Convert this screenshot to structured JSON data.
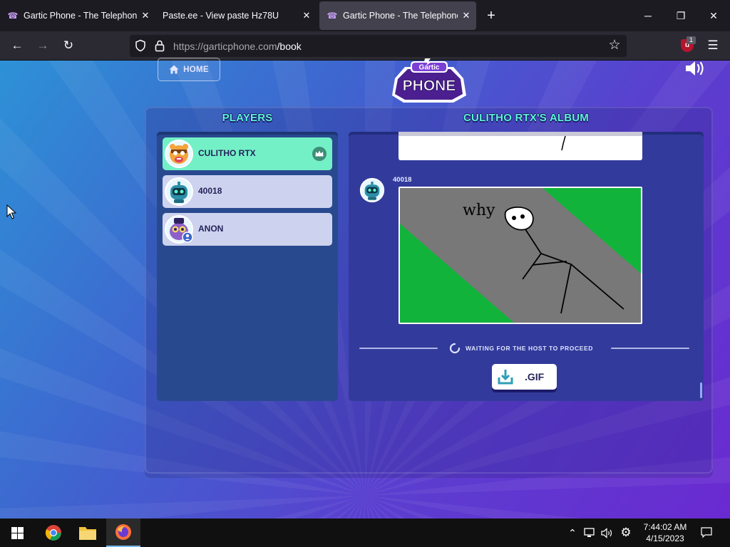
{
  "browser": {
    "tabs": [
      {
        "title": "Gartic Phone - The Telephone G",
        "active": false
      },
      {
        "title": "Paste.ee - View paste Hz78U",
        "active": false
      },
      {
        "title": "Gartic Phone - The Telephone G",
        "active": true
      }
    ],
    "url_host": "https://garticphone.com",
    "url_path": "/book",
    "extension_badge": "1",
    "colors": {
      "chrome_bg": "#1c1b22",
      "toolbar_bg": "#2b2a33",
      "active_tab": "#42414d"
    }
  },
  "game": {
    "home_label": "HOME",
    "logo_top": "Gartic",
    "logo_main": "PHONE",
    "players_heading": "PLAYERS",
    "album_heading": "CULITHO RTX'S ALBUM",
    "players": [
      {
        "name": "CULITHO RTX",
        "host": true,
        "avatar": "tiger-avatar"
      },
      {
        "name": "40018",
        "host": false,
        "avatar": "robot-avatar"
      },
      {
        "name": "ANON",
        "host": false,
        "avatar": "owl-avatar"
      }
    ],
    "album": {
      "drawer_name": "40018",
      "drawing_text": "why",
      "waiting_text": "WAITING FOR THE HOST TO PROCEED",
      "gif_label": ".GIF"
    },
    "colors": {
      "accent": "#5ef3d4",
      "host_row": "#74f0c7",
      "player_row": "#cdd3ee",
      "grass": "#12b33b",
      "road": "#787878"
    }
  },
  "taskbar": {
    "apps": [
      "windows-start",
      "chrome",
      "file-explorer",
      "firefox"
    ],
    "time": "7:44:02 AM",
    "date": "4/15/2023"
  }
}
